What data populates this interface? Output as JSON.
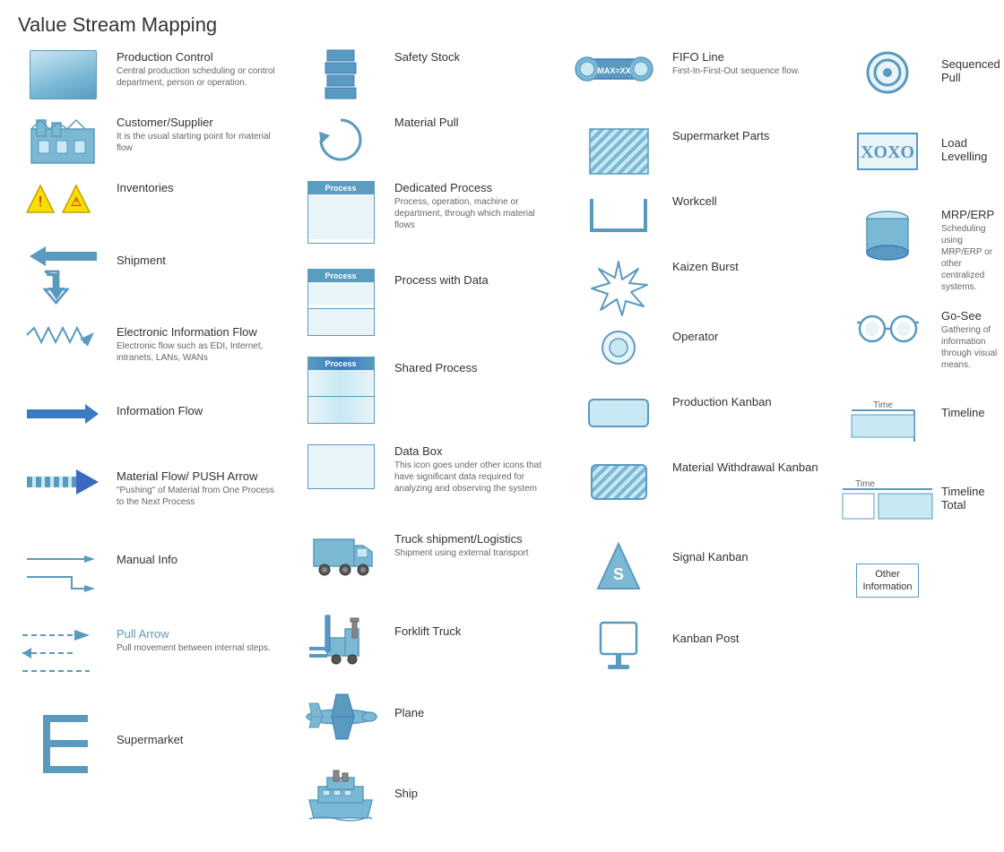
{
  "title": "Value Stream Mapping",
  "columns": [
    {
      "id": "col1",
      "items": [
        {
          "id": "production-control",
          "label": "Production Control",
          "desc": "Central production scheduling or control department, person or operation.",
          "icon": "production-control-icon"
        },
        {
          "id": "customer-supplier",
          "label": "Customer/Supplier",
          "desc": "It is the usual starting point for material flow",
          "icon": "customer-supplier-icon"
        },
        {
          "id": "inventories",
          "label": "Inventories",
          "desc": "",
          "icon": "inventories-icon"
        },
        {
          "id": "shipment",
          "label": "Shipment",
          "desc": "",
          "icon": "shipment-icon"
        },
        {
          "id": "electronic-info-flow",
          "label": "Electronic Information Flow",
          "desc": "Electronic flow such as EDI, Internet, intranets, LANs, WANs",
          "icon": "electronic-info-flow-icon"
        },
        {
          "id": "information-flow",
          "label": "Information Flow",
          "desc": "",
          "icon": "information-flow-icon"
        },
        {
          "id": "material-flow-push",
          "label": "Material Flow/ PUSH Arrow",
          "desc": "\"Pushing\" of Material from One Process to the Next Process",
          "icon": "material-flow-push-icon"
        },
        {
          "id": "manual-info",
          "label": "Manual Info",
          "desc": "",
          "icon": "manual-info-icon"
        },
        {
          "id": "pull-arrow",
          "label": "Pull Arrow",
          "desc": "Pull movement between internal steps.",
          "icon": "pull-arrow-icon"
        },
        {
          "id": "supermarket",
          "label": "Supermarket",
          "desc": "",
          "icon": "supermarket-icon"
        }
      ]
    },
    {
      "id": "col2",
      "items": [
        {
          "id": "safety-stock",
          "label": "Safety Stock",
          "desc": "",
          "icon": "safety-stock-icon"
        },
        {
          "id": "material-pull",
          "label": "Material Pull",
          "desc": "",
          "icon": "material-pull-icon"
        },
        {
          "id": "dedicated-process",
          "label": "Dedicated Process",
          "desc": "Process, operation, machine or department, through which material flows",
          "icon": "dedicated-process-icon"
        },
        {
          "id": "process-with-data",
          "label": "Process with Data",
          "desc": "",
          "icon": "process-with-data-icon"
        },
        {
          "id": "shared-process",
          "label": "Shared Process",
          "desc": "",
          "icon": "shared-process-icon"
        },
        {
          "id": "data-box",
          "label": "Data Box",
          "desc": "This icon goes under other icons that have significant data required for analyzing and observing the system",
          "icon": "data-box-icon"
        },
        {
          "id": "truck-shipment",
          "label": "Truck shipment/Logistics",
          "desc": "Shipment using external transport",
          "icon": "truck-shipment-icon"
        },
        {
          "id": "forklift-truck",
          "label": "Forklift Truck",
          "desc": "",
          "icon": "forklift-truck-icon"
        },
        {
          "id": "plane",
          "label": "Plane",
          "desc": "",
          "icon": "plane-icon"
        },
        {
          "id": "ship",
          "label": "Ship",
          "desc": "",
          "icon": "ship-icon"
        }
      ]
    },
    {
      "id": "col3",
      "items": [
        {
          "id": "fifo-line",
          "label": "FIFO Line",
          "desc": "First-In-First-Out sequence flow.",
          "icon": "fifo-line-icon",
          "sublabel": "MAX=XX"
        },
        {
          "id": "supermarket-parts",
          "label": "Supermarket Parts",
          "desc": "",
          "icon": "supermarket-parts-icon"
        },
        {
          "id": "workcell",
          "label": "Workcell",
          "desc": "",
          "icon": "workcell-icon"
        },
        {
          "id": "kaizen-burst",
          "label": "Kaizen Burst",
          "desc": "",
          "icon": "kaizen-burst-icon"
        },
        {
          "id": "operator",
          "label": "Operator",
          "desc": "",
          "icon": "operator-icon"
        },
        {
          "id": "production-kanban",
          "label": "Production Kanban",
          "desc": "",
          "icon": "production-kanban-icon"
        },
        {
          "id": "material-withdrawal-kanban",
          "label": "Material Withdrawal Kanban",
          "desc": "",
          "icon": "material-withdrawal-kanban-icon"
        },
        {
          "id": "signal-kanban",
          "label": "Signal Kanban",
          "desc": "",
          "icon": "signal-kanban-icon"
        },
        {
          "id": "kanban-post",
          "label": "Kanban Post",
          "desc": "",
          "icon": "kanban-post-icon"
        }
      ]
    },
    {
      "id": "col4",
      "items": [
        {
          "id": "sequenced-pull",
          "label": "Sequenced Pull",
          "desc": "",
          "icon": "sequenced-pull-icon"
        },
        {
          "id": "load-levelling",
          "label": "Load Levelling",
          "desc": "",
          "icon": "load-levelling-icon"
        },
        {
          "id": "mrp-erp",
          "label": "MRP/ERP",
          "desc": "Scheduling using MRP/ERP or other centralized systems.",
          "icon": "mrp-erp-icon"
        },
        {
          "id": "go-see",
          "label": "Go-See",
          "desc": "Gathering of information through visual means.",
          "icon": "go-see-icon"
        },
        {
          "id": "timeline",
          "label": "Timeline",
          "desc": "",
          "icon": "timeline-icon"
        },
        {
          "id": "timeline-total",
          "label": "Timeline Total",
          "desc": "",
          "icon": "timeline-total-icon"
        },
        {
          "id": "other-information",
          "label": "Other Information",
          "desc": "",
          "icon": "other-information-icon"
        }
      ]
    }
  ]
}
